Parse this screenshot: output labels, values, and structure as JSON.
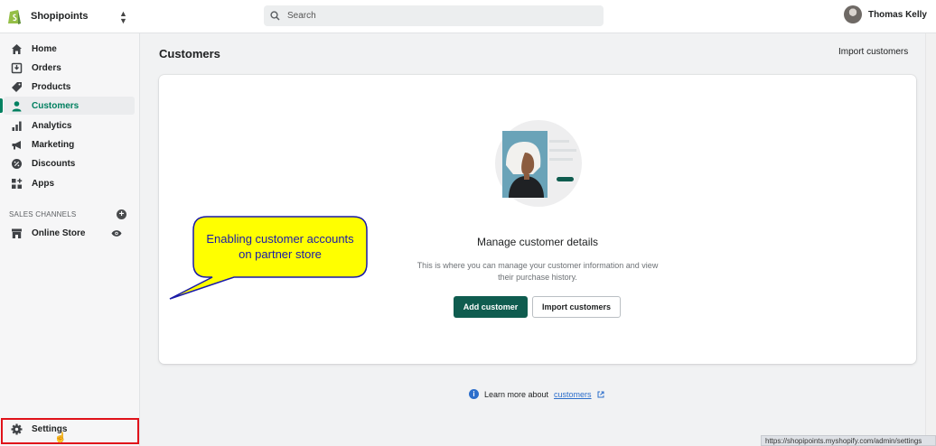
{
  "topbar": {
    "store_name": "Shopipoints",
    "search_placeholder": "Search",
    "user_name": "Thomas Kelly"
  },
  "sidebar": {
    "items": [
      {
        "label": "Home",
        "icon": "home-icon"
      },
      {
        "label": "Orders",
        "icon": "orders-icon"
      },
      {
        "label": "Products",
        "icon": "tag-icon"
      },
      {
        "label": "Customers",
        "icon": "person-icon",
        "active": true
      },
      {
        "label": "Analytics",
        "icon": "bar-chart-icon"
      },
      {
        "label": "Marketing",
        "icon": "megaphone-icon"
      },
      {
        "label": "Discounts",
        "icon": "discount-icon"
      },
      {
        "label": "Apps",
        "icon": "apps-icon"
      }
    ],
    "sales_channels_label": "SALES CHANNELS",
    "online_store_label": "Online Store",
    "settings_label": "Settings"
  },
  "main": {
    "title": "Customers",
    "import_link": "Import customers",
    "empty_state": {
      "heading": "Manage customer details",
      "body": "This is where you can manage your customer information and view their purchase history.",
      "primary_button": "Add customer",
      "secondary_button": "Import customers"
    },
    "learn_more_prefix": "Learn more about",
    "learn_more_link": "customers"
  },
  "callout": {
    "line1": "Enabling customer accounts",
    "line2": "on partner store"
  },
  "status_url": "https://shopipoints.myshopify.com/admin/settings",
  "colors": {
    "accent": "#008060",
    "primary_button": "#0f5c4f",
    "link": "#2c6ecb",
    "highlight_border": "#e0121a",
    "callout_fill": "#ffff00",
    "callout_border": "#1a1aa8"
  }
}
